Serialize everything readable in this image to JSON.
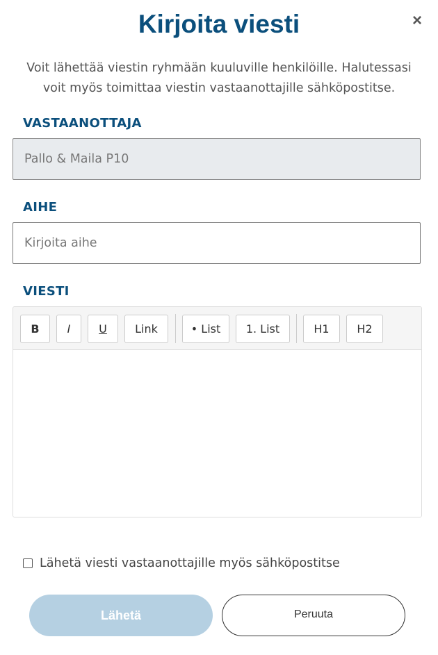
{
  "dialog": {
    "title": "Kirjoita viesti",
    "close_symbol": "×",
    "description": "Voit lähettää viestin ryhmään kuuluville henkilöille. Halutessasi voit myös toimittaa viestin vastaanottajille sähköpostitse."
  },
  "recipient": {
    "label": "VASTAANOTTAJA",
    "value": "Pallo & Maila P10"
  },
  "subject": {
    "label": "AIHE",
    "placeholder": "Kirjoita aihe",
    "value": ""
  },
  "message": {
    "label": "VIESTI",
    "body": "",
    "toolbar": {
      "bold": "B",
      "italic": "I",
      "underline": "U",
      "link": "Link",
      "bullet_list": "• List",
      "numbered_list": "1. List",
      "h1": "H1",
      "h2": "H2"
    }
  },
  "email_option": {
    "label": "Lähetä viesti vastaanottajille myös sähköpostitse",
    "checked": false
  },
  "actions": {
    "send_label": "Lähetä",
    "cancel_label": "Peruuta"
  },
  "colors": {
    "accent": "#0b4f7c",
    "send_button_disabled": "#b5d0e2",
    "disabled_field": "#e8ebee"
  },
  "icons": {
    "close": "close-icon",
    "checkbox": "checkbox-icon"
  }
}
